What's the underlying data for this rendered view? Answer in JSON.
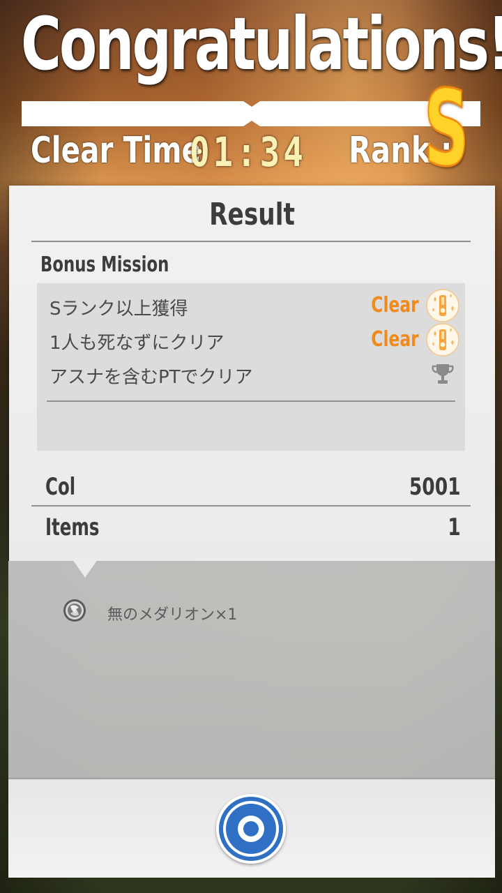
{
  "header": {
    "title": "Congratulations!!",
    "clear_time_label": "Clear Time",
    "clear_time_value": "01:34",
    "rank_label": "Rank :",
    "rank_value": "S"
  },
  "result": {
    "title": "Result",
    "bonus_mission_label": "Bonus Mission",
    "missions": [
      {
        "text": "Sランク以上獲得",
        "status": "Clear",
        "icon": "medal-icon"
      },
      {
        "text": "1人も死なずにクリア",
        "status": "Clear",
        "icon": "medal-icon"
      },
      {
        "text": "アスナを含むPTでクリア",
        "status": "",
        "icon": "trophy-icon"
      }
    ],
    "col_label": "Col",
    "col_value": "5001",
    "items_label": "Items",
    "items_value": "1"
  },
  "items_list": [
    {
      "text": "無のメダリオン×1",
      "icon": "medallion-icon"
    }
  ],
  "bottom": {
    "ok_button_icon": "confirm-circle-icon"
  },
  "colors": {
    "clear_orange": "#f08a1c",
    "rank_gold": "#ffd22a",
    "button_blue": "#2f6fc4"
  }
}
